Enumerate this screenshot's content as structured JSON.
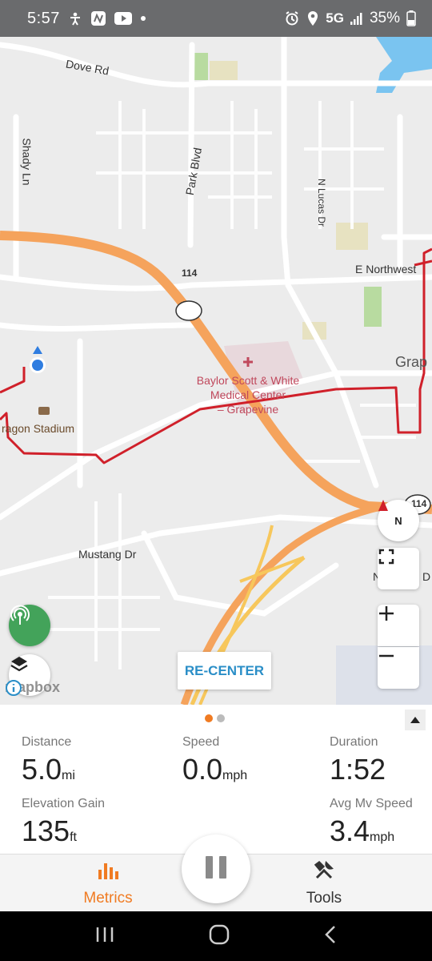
{
  "status_bar": {
    "time": "5:57",
    "network": "5G",
    "battery": "35%",
    "left_icons": [
      "accessibility-icon",
      "app-n-icon",
      "youtube-icon",
      "dot-icon"
    ],
    "right_icons": [
      "alarm-icon",
      "location-icon",
      "signal-icon",
      "battery-icon"
    ]
  },
  "map": {
    "road_labels": [
      "Dove Rd",
      "Shady Ln",
      "Park Blvd",
      "N Lucas Dr",
      "E Northwest",
      "Grap",
      "Mustang Dr",
      "N",
      "D"
    ],
    "shields": [
      "114",
      "114"
    ],
    "poi": {
      "name_line1": "Baylor Scott & White",
      "name_line2": "Medical Center",
      "name_line3": "– Grapevine"
    },
    "stadium_label": "ragon Stadium",
    "attribution": "mapbox",
    "compass_label": "N",
    "recenter_label": "RE-CENTER",
    "colors": {
      "route": "#d0202a",
      "highway": "#f5a35c",
      "user": "#2f7de0"
    }
  },
  "panel": {
    "page_dots": [
      "active",
      "inactive"
    ],
    "metrics": [
      {
        "label": "Distance",
        "value": "5.0",
        "unit": "mi"
      },
      {
        "label": "Speed",
        "value": "0.0",
        "unit": "mph"
      },
      {
        "label": "Duration",
        "value": "1:52",
        "unit": ""
      },
      {
        "label": "Elevation Gain",
        "value": "135",
        "unit": "ft"
      },
      {
        "label": "Avg Mv Speed",
        "value": "3.4",
        "unit": "mph"
      }
    ]
  },
  "bottom_nav": {
    "items": [
      {
        "label": "Metrics",
        "icon": "bar-chart-icon",
        "active": true
      },
      {
        "label": "Tools",
        "icon": "tools-icon",
        "active": false
      }
    ],
    "accent": "#f07b22"
  }
}
